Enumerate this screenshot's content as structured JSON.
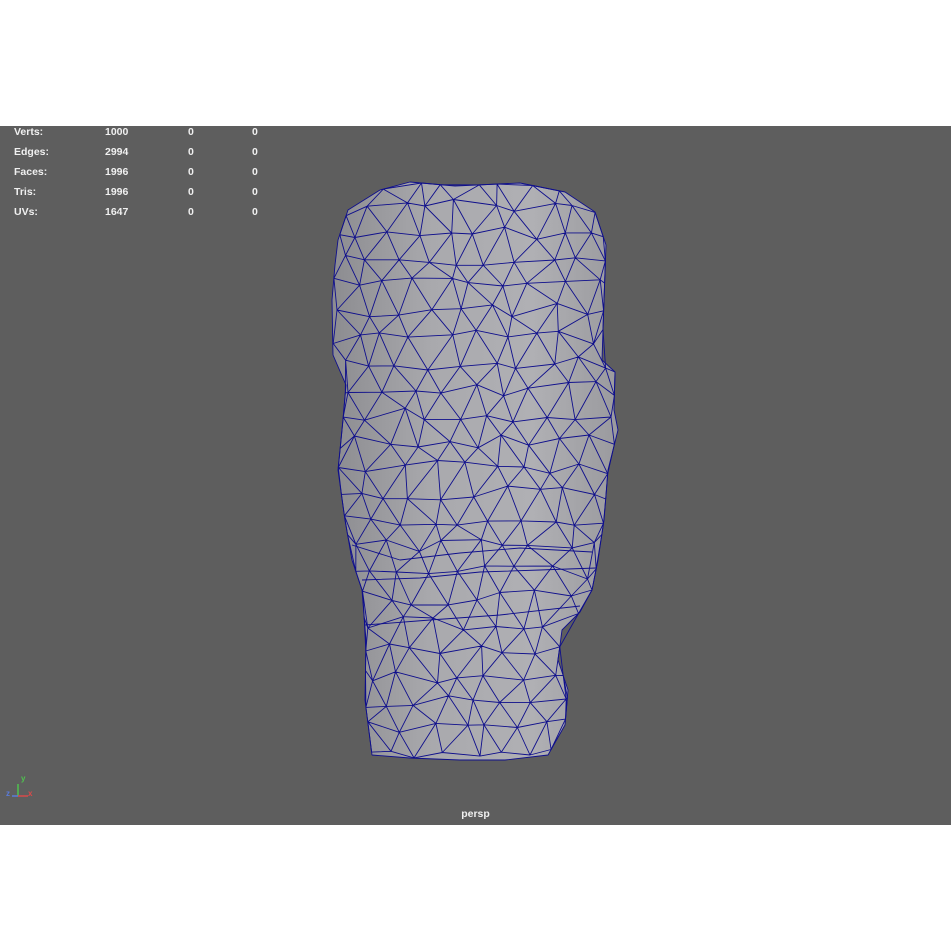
{
  "viewport": {
    "camera_name": "persp",
    "background_color": "#5e5e5e",
    "mesh_fill_color": "#a8a8ab",
    "wire_color": "#0f0f8c"
  },
  "poly_count": {
    "rows": [
      {
        "label": "Verts:",
        "total": "1000",
        "selected": "0",
        "highlighted": "0"
      },
      {
        "label": "Edges:",
        "total": "2994",
        "selected": "0",
        "highlighted": "0"
      },
      {
        "label": "Faces:",
        "total": "1996",
        "selected": "0",
        "highlighted": "0"
      },
      {
        "label": "Tris:",
        "total": "1996",
        "selected": "0",
        "highlighted": "0"
      },
      {
        "label": "UVs:",
        "total": "1647",
        "selected": "0",
        "highlighted": "0"
      }
    ]
  },
  "axis_gizmo": {
    "labels": {
      "y": "y",
      "z": "z",
      "x": "x"
    },
    "colors": {
      "y": "#4fc24f",
      "z": "#5a7bd9",
      "x": "#d94a4a"
    }
  }
}
